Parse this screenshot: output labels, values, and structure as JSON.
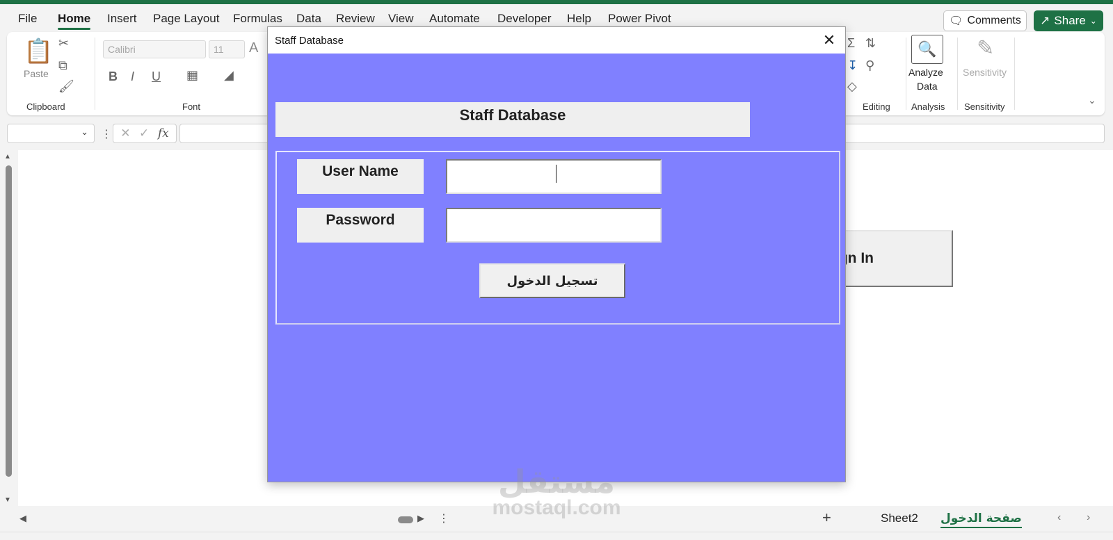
{
  "menu": {
    "items": [
      "File",
      "Home",
      "Insert",
      "Page Layout",
      "Formulas",
      "Data",
      "Review",
      "View",
      "Automate",
      "Developer",
      "Help",
      "Power Pivot"
    ],
    "active": "Home",
    "comments_label": "Comments",
    "share_label": "Share"
  },
  "ribbon": {
    "paste_label": "Paste",
    "font_name": "Calibri",
    "font_size": "11",
    "groups": {
      "clipboard": "Clipboard",
      "font": "Font",
      "editing": "Editing",
      "analysis": "Analysis",
      "sensitivity": "Sensitivity"
    },
    "analyze_data_label": "Analyze",
    "analyze_data_label2": "Data",
    "sensitivity_button_label": "Sensitivity"
  },
  "formula_bar": {
    "fx_label": "fx",
    "formula_value": ""
  },
  "sheet": {
    "signin_button_partial": "ign In"
  },
  "tabs": {
    "items": [
      "Sheet2",
      "صفحة الدخول"
    ],
    "active": "صفحة الدخول"
  },
  "dialog": {
    "title": "Staff Database",
    "header": "Staff Database",
    "username_label": "User Name",
    "password_label": "Password",
    "username_value": "",
    "password_value": "",
    "login_button": "تسجيل الدخول",
    "background_color": "#8080ff"
  },
  "watermark": {
    "arabic": "مستقل",
    "url": "mostaql.com"
  }
}
